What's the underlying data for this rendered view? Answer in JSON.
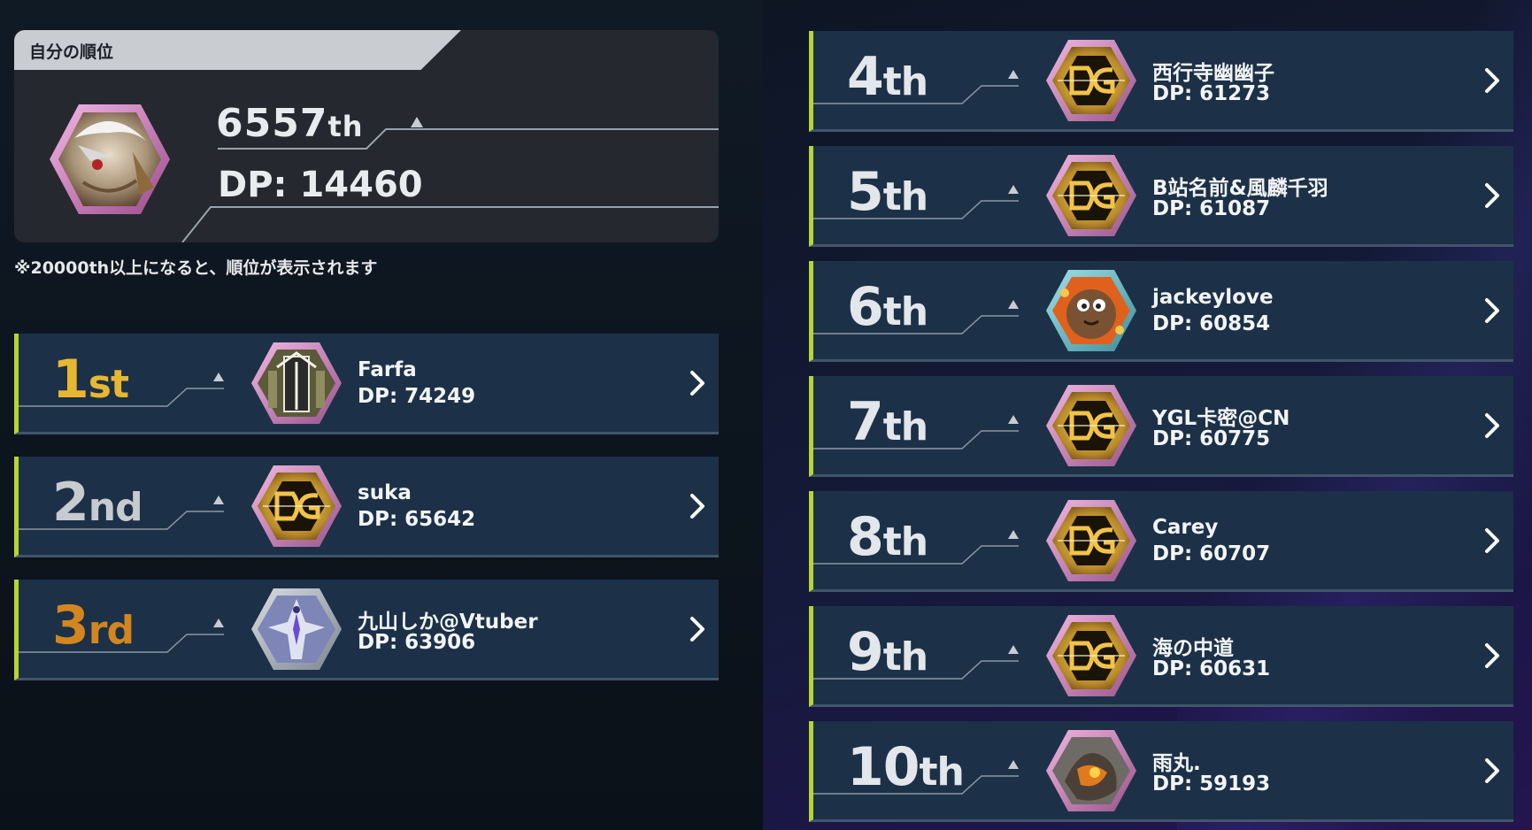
{
  "self": {
    "header": "自分の順位",
    "rank_number": "6557",
    "rank_suffix": "th",
    "dp": "DP: 14460",
    "note": "※20000th以上になると、順位が表示されます"
  },
  "colors": {
    "row_bg": "#1c3148",
    "row_accent": "#b7d532",
    "gold": "#e8b731",
    "silver": "#c7cbd0",
    "bronze": "#d3861f"
  },
  "left_rows": [
    {
      "num": "1",
      "suffix": "st",
      "name": "Farfa",
      "dp": "DP: 74249",
      "icon": "castle-avatar-icon"
    },
    {
      "num": "2",
      "suffix": "nd",
      "name": "suka",
      "dp": "DP: 65642",
      "icon": "dg-emblem-icon"
    },
    {
      "num": "3",
      "suffix": "rd",
      "name": "九山しか@Vtuber",
      "dp": "DP: 63906",
      "icon": "dragon-avatar-icon"
    }
  ],
  "right_rows": [
    {
      "num": "4",
      "suffix": "th",
      "name": "西行寺幽幽子",
      "dp": "DP: 61273",
      "icon": "dg-emblem-icon"
    },
    {
      "num": "5",
      "suffix": "th",
      "name": "B站名前&風麟千羽",
      "dp": "DP: 61087",
      "icon": "dg-emblem-icon"
    },
    {
      "num": "6",
      "suffix": "th",
      "name": "jackeylove",
      "dp": "DP: 60854",
      "icon": "kuriboh-avatar-icon"
    },
    {
      "num": "7",
      "suffix": "th",
      "name": "YGL卡密@CN",
      "dp": "DP: 60775",
      "icon": "dg-emblem-icon"
    },
    {
      "num": "8",
      "suffix": "th",
      "name": "Carey",
      "dp": "DP: 60707",
      "icon": "dg-emblem-icon"
    },
    {
      "num": "9",
      "suffix": "th",
      "name": "海の中道",
      "dp": "DP: 60631",
      "icon": "dg-emblem-icon"
    },
    {
      "num": "10",
      "suffix": "th",
      "name": "雨丸.",
      "dp": "DP: 59193",
      "icon": "fire-monster-avatar-icon"
    }
  ]
}
